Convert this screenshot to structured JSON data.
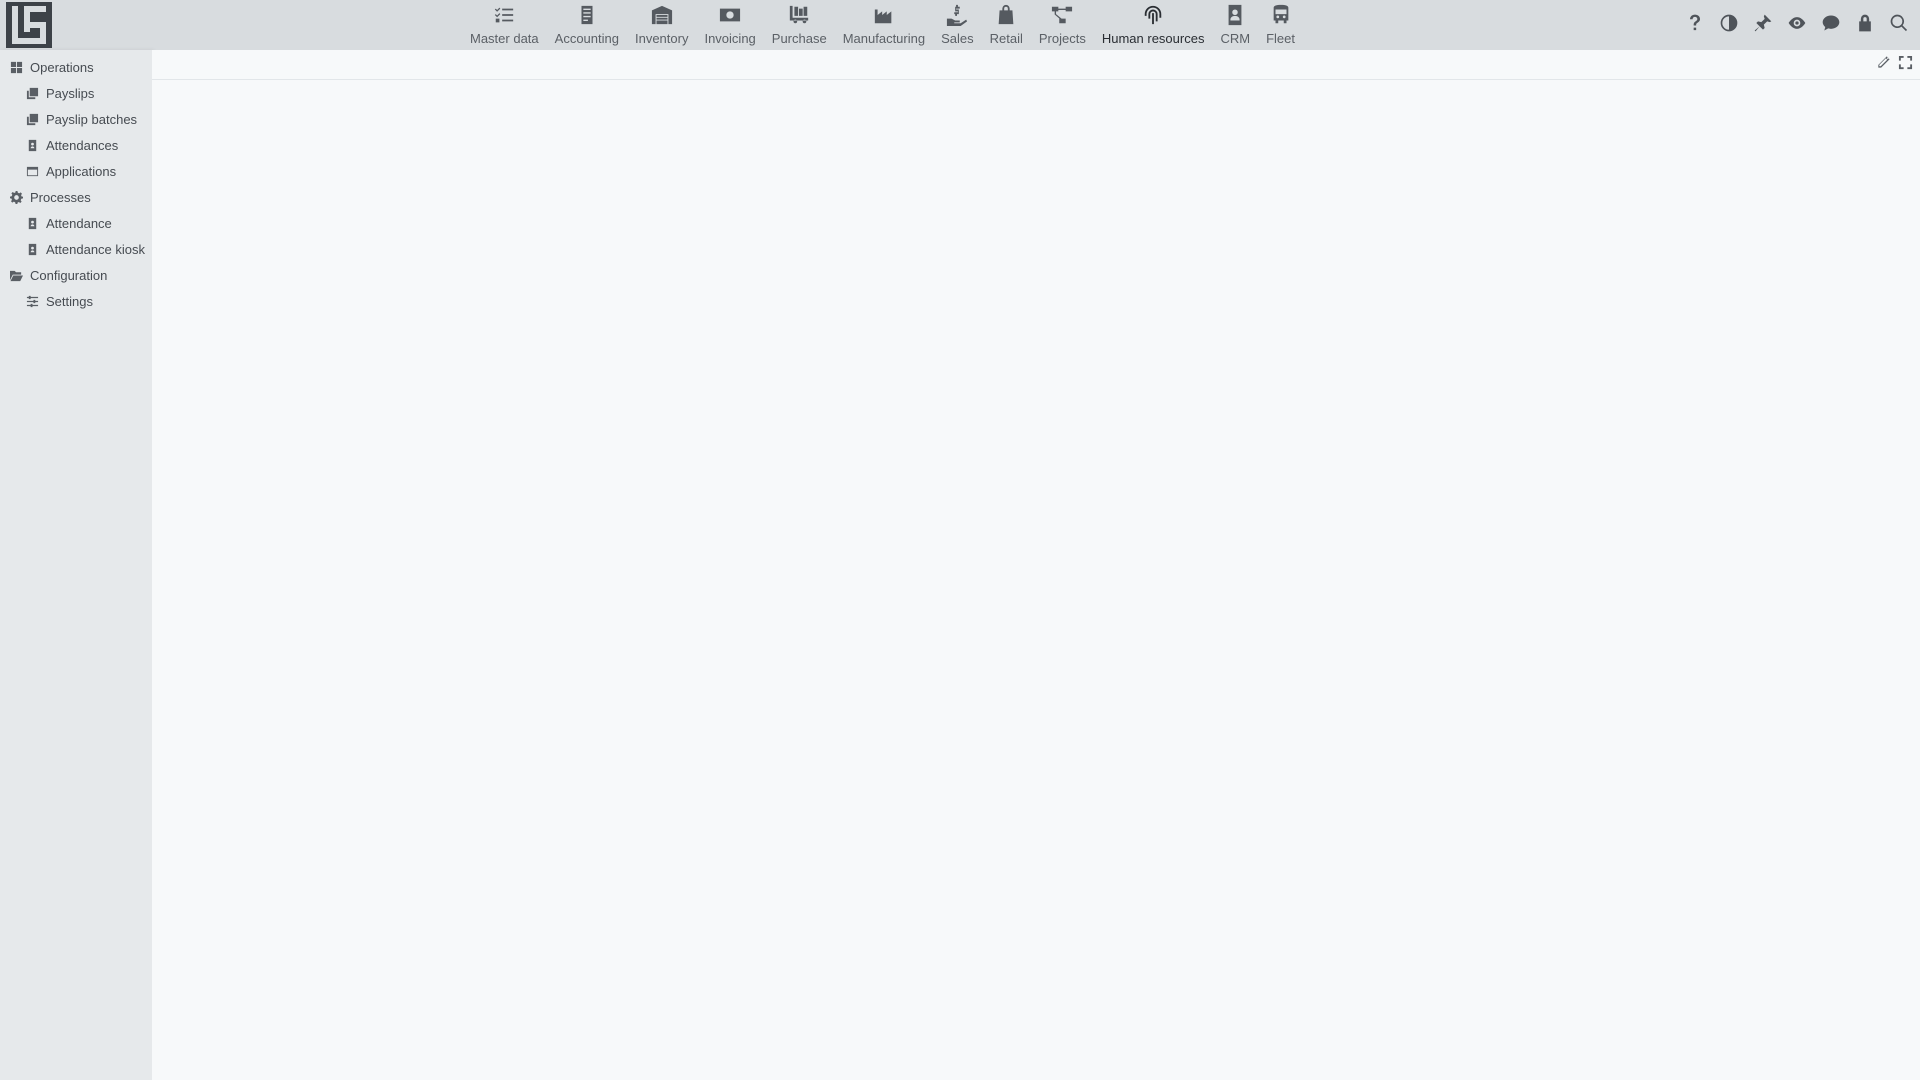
{
  "nav": {
    "items": [
      {
        "label": "Master data",
        "icon": "checklist-icon"
      },
      {
        "label": "Accounting",
        "icon": "ledger-icon"
      },
      {
        "label": "Inventory",
        "icon": "warehouse-icon"
      },
      {
        "label": "Invoicing",
        "icon": "banknote-icon"
      },
      {
        "label": "Purchase",
        "icon": "cart-icon"
      },
      {
        "label": "Manufacturing",
        "icon": "factory-icon"
      },
      {
        "label": "Sales",
        "icon": "hand-dollar-icon"
      },
      {
        "label": "Retail",
        "icon": "shopping-bag-icon"
      },
      {
        "label": "Projects",
        "icon": "project-diagram-icon"
      },
      {
        "label": "Human resources",
        "icon": "fingerprint-icon",
        "active": true
      },
      {
        "label": "CRM",
        "icon": "address-book-icon"
      },
      {
        "label": "Fleet",
        "icon": "bus-icon"
      }
    ]
  },
  "tools": [
    "help-icon",
    "contrast-icon",
    "pin-icon",
    "eye-icon",
    "chat-icon",
    "lock-icon",
    "search-icon"
  ],
  "sidebar": {
    "groups": [
      {
        "label": "Operations",
        "icon": "windows-icon",
        "items": [
          {
            "label": "Payslips",
            "icon": "copy-icon"
          },
          {
            "label": "Payslip batches",
            "icon": "copy-icon"
          },
          {
            "label": "Attendances",
            "icon": "id-badge-icon"
          },
          {
            "label": "Applications",
            "icon": "window-icon"
          }
        ]
      },
      {
        "label": "Processes",
        "icon": "cog-icon",
        "items": [
          {
            "label": "Attendance",
            "icon": "id-badge-icon"
          },
          {
            "label": "Attendance kiosk",
            "icon": "id-badge-icon"
          }
        ]
      },
      {
        "label": "Configuration",
        "icon": "folder-open-icon",
        "items": [
          {
            "label": "Settings",
            "icon": "sliders-icon"
          }
        ]
      }
    ]
  },
  "content_toolbar": [
    "pencil-icon",
    "expand-icon"
  ],
  "colors": {
    "topbar": "#d8dcdf",
    "sidebar": "#e6e9eb",
    "content": "#f7f9fa",
    "icon": "#555a60"
  }
}
